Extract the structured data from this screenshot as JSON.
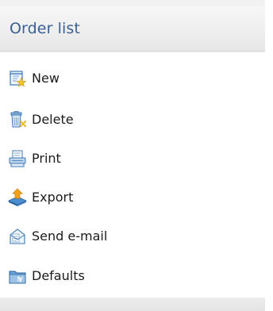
{
  "panel": {
    "title": "Order list"
  },
  "actions": [
    {
      "label": "New",
      "icon": "new-order-icon"
    },
    {
      "label": "Delete",
      "icon": "delete-icon"
    },
    {
      "label": "Print",
      "icon": "print-icon"
    },
    {
      "label": "Export",
      "icon": "export-icon"
    },
    {
      "label": "Send e-mail",
      "icon": "send-email-icon"
    },
    {
      "label": "Defaults",
      "icon": "defaults-icon"
    }
  ],
  "colors": {
    "title": "#3a5f93",
    "header_bg": "#ececec",
    "list_bg": "#ffffff"
  }
}
